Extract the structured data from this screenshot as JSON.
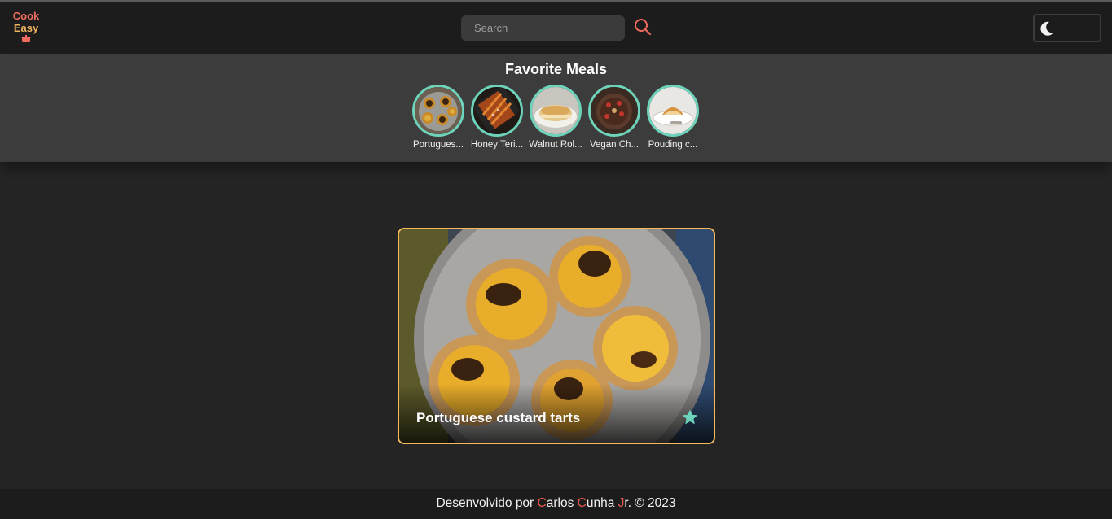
{
  "brand": {
    "line1": "Cook",
    "line2": "Easy",
    "line1_color": "#ef6b5e",
    "line2_color": "#f2b35c"
  },
  "search": {
    "placeholder": "Search",
    "icon": "search-icon"
  },
  "theme_toggle": {
    "icon": "moon-icon"
  },
  "favorites": {
    "title": "Favorite Meals",
    "items": [
      {
        "name": "Portugues...",
        "full_name": "Portuguese custard tarts"
      },
      {
        "name": "Honey Teri..."
      },
      {
        "name": "Walnut Rol..."
      },
      {
        "name": "Vegan Ch..."
      },
      {
        "name": "Pouding c..."
      }
    ]
  },
  "meal": {
    "title": "Portuguese custard tarts",
    "favorite_icon": "star-icon"
  },
  "footer": {
    "prefix": "Desenvolvido por ",
    "c1": "C",
    "t1": "arlos ",
    "c2": "C",
    "t2": "unha ",
    "c3": "J",
    "t3": "r. © 2023"
  },
  "colors": {
    "accent": "#6ed3bb",
    "card_border": "#f7b95a",
    "brand_red": "#ef5a4e"
  }
}
